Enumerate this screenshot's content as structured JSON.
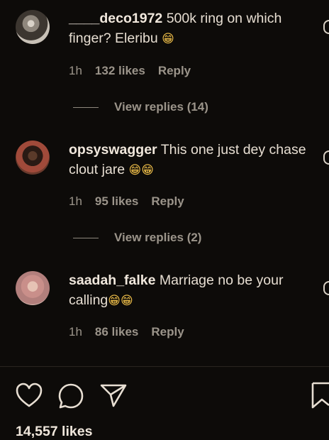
{
  "comments": [
    {
      "username": "____deco1972",
      "text": "500k ring on which finger? Eleribu",
      "emoji": "😁",
      "time": "1h",
      "likes": "132 likes",
      "reply": "Reply",
      "view_replies": "View replies (14)"
    },
    {
      "username": "opsyswagger",
      "text": "This one just dey chase clout jare",
      "emoji": "😁😁",
      "time": "1h",
      "likes": "95 likes",
      "reply": "Reply",
      "view_replies": "View replies (2)"
    },
    {
      "username": "saadah_falke",
      "text": "Marriage no be your calling",
      "emoji": "😁😁",
      "time": "1h",
      "likes": "86 likes",
      "reply": "Reply"
    }
  ],
  "post": {
    "likes": "14,557 likes"
  },
  "icons": {
    "like": "heart-icon",
    "comment": "speech-bubble-icon",
    "share": "paper-plane-icon",
    "save": "bookmark-icon"
  },
  "colors": {
    "background": "#0d0b09",
    "text": "#e7ded2",
    "muted": "#9b948a"
  }
}
